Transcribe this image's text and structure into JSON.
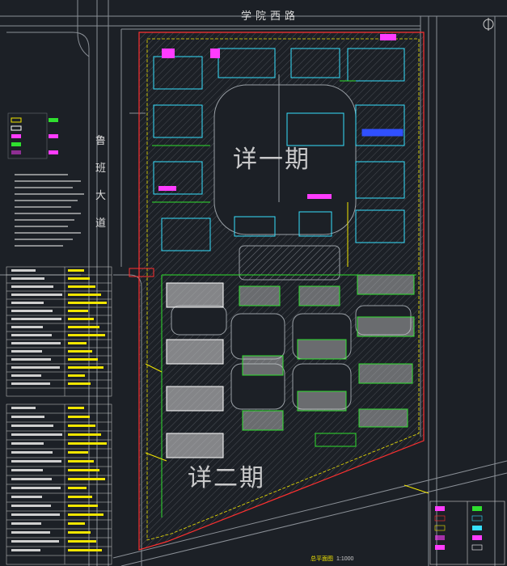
{
  "labels": {
    "road_top": "学院西路",
    "road_left": "鲁班大道",
    "phase_1": "详一期",
    "phase_2": "详二期",
    "plan_title": "总平面图",
    "plan_scale": "1:1000"
  },
  "colors": {
    "background": "#1c2026",
    "road_line": "#8a8f96",
    "site_boundary": "#ff3030",
    "hatch": "#7a7f86",
    "building": "#ffffff",
    "landscape": "#2fe02f",
    "label_yellow": "#f2e600",
    "magenta": "#ff3cff",
    "cyan": "#36e0ff",
    "blue": "#3050ff"
  }
}
